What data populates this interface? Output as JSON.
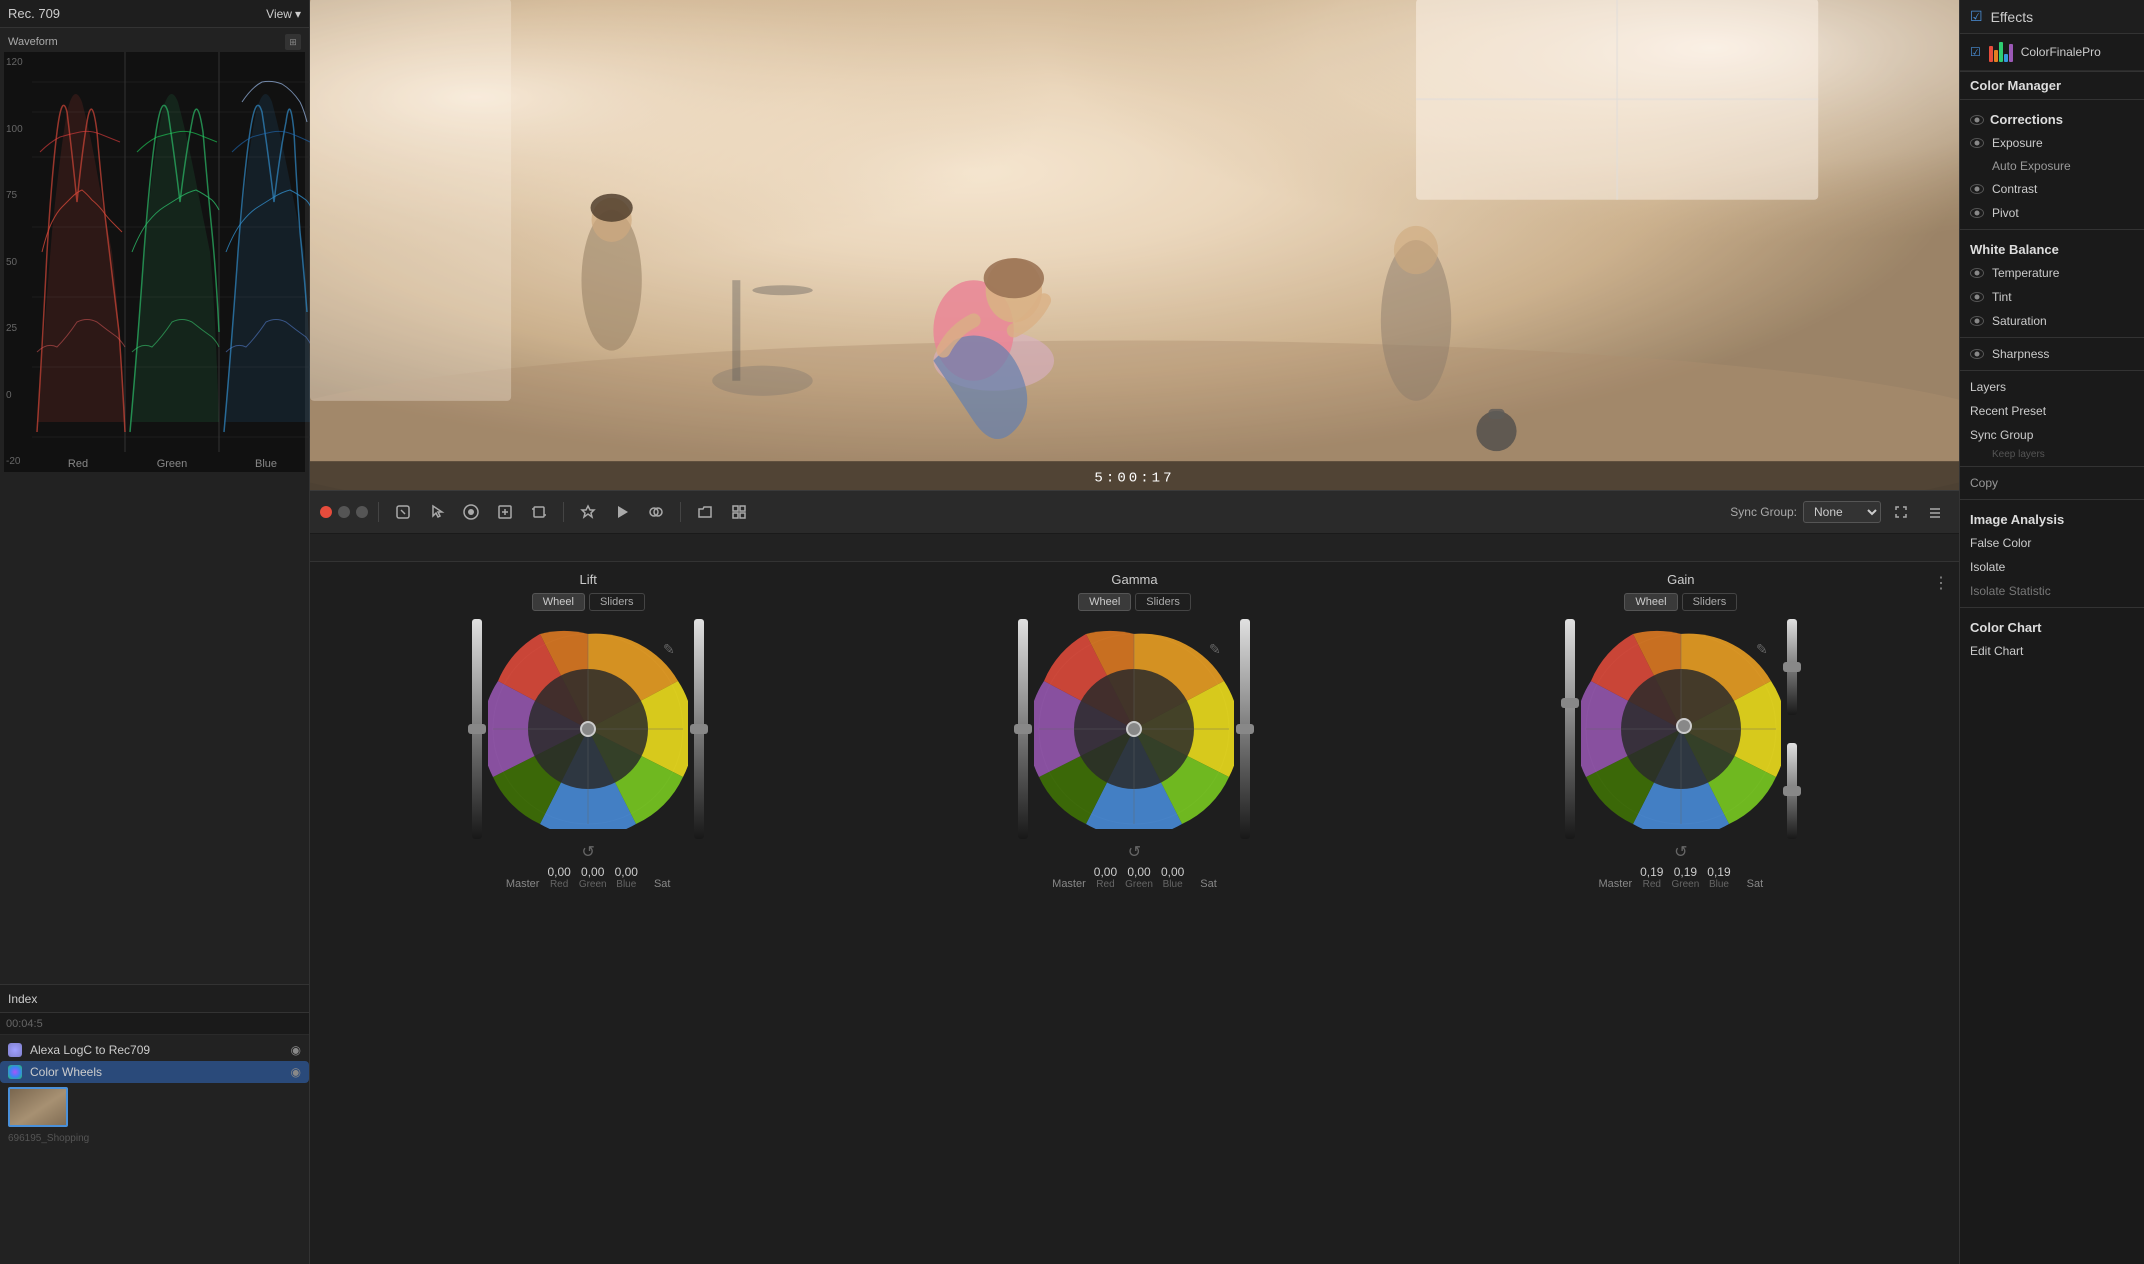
{
  "header": {
    "rec_label": "Rec. 709",
    "view_btn": "View"
  },
  "waveform": {
    "title": "Waveform",
    "labels": [
      "120",
      "100",
      "75",
      "50",
      "25",
      "0",
      "-20"
    ],
    "channels": [
      {
        "name": "Red",
        "color": "#e74c3c"
      },
      {
        "name": "Green",
        "color": "#2ecc71"
      },
      {
        "name": "Blue",
        "color": "#3498db"
      }
    ]
  },
  "index": {
    "title": "Index",
    "timecode": "00:04:5",
    "layers": [
      {
        "name": "Alexa LogC to Rec709",
        "active": false
      },
      {
        "name": "Color Wheels",
        "active": true
      }
    ]
  },
  "toolbar": {
    "sync_group_label": "Sync Group:",
    "sync_group_value": "None"
  },
  "timecode_display": "5:00:17",
  "wheels": {
    "lift": {
      "title": "Lift",
      "tabs": [
        "Wheel",
        "Sliders"
      ],
      "active_tab": "Wheel",
      "values": {
        "red": "0,00",
        "green": "0,00",
        "blue": "0,00",
        "master_label": "Master",
        "sat_label": "Sat",
        "red_label": "Red",
        "green_label": "Green",
        "blue_label": "Blue"
      }
    },
    "gamma": {
      "title": "Gamma",
      "tabs": [
        "Wheel",
        "Sliders"
      ],
      "active_tab": "Wheel",
      "values": {
        "red": "0,00",
        "green": "0,00",
        "blue": "0,00",
        "master_label": "Master",
        "sat_label": "Sat",
        "red_label": "Red",
        "green_label": "Green",
        "blue_label": "Blue"
      }
    },
    "gain": {
      "title": "Gain",
      "tabs": [
        "Wheel",
        "Sliders"
      ],
      "active_tab": "Wheel",
      "values": {
        "red": "0,19",
        "green": "0,19",
        "blue": "0,19",
        "master_label": "Master",
        "sat_label": "Sat",
        "red_label": "Red",
        "green_label": "Green",
        "blue_label": "Blue"
      }
    }
  },
  "right_panel": {
    "effects_title": "Effects",
    "plugin_name": "ColorFinalePro",
    "color_manager_title": "Color Manager",
    "sections": {
      "corrections_title": "Corrections",
      "corrections_items": [
        "Exposure",
        "Auto Exposure",
        "Contrast",
        "Pivot"
      ],
      "white_balance_title": "White Balance",
      "white_balance_items": [
        "Temperature",
        "Tint",
        "Saturation"
      ],
      "sharpness_title": "Sharpness",
      "sharpness_items": [],
      "layers_title": "Layers",
      "recent_preset_title": "Recent Preset",
      "sync_group_title": "Sync Group",
      "keep_layers": "Keep layers",
      "copy_label": "Copy",
      "image_analysis_title": "Image Analysis",
      "false_color_title": "False Color",
      "isolate_title": "Isolate",
      "isolate_stats_title": "Isolate Statistic",
      "color_chart_title": "Color Chart",
      "edit_chart_title": "Edit Chart"
    }
  }
}
